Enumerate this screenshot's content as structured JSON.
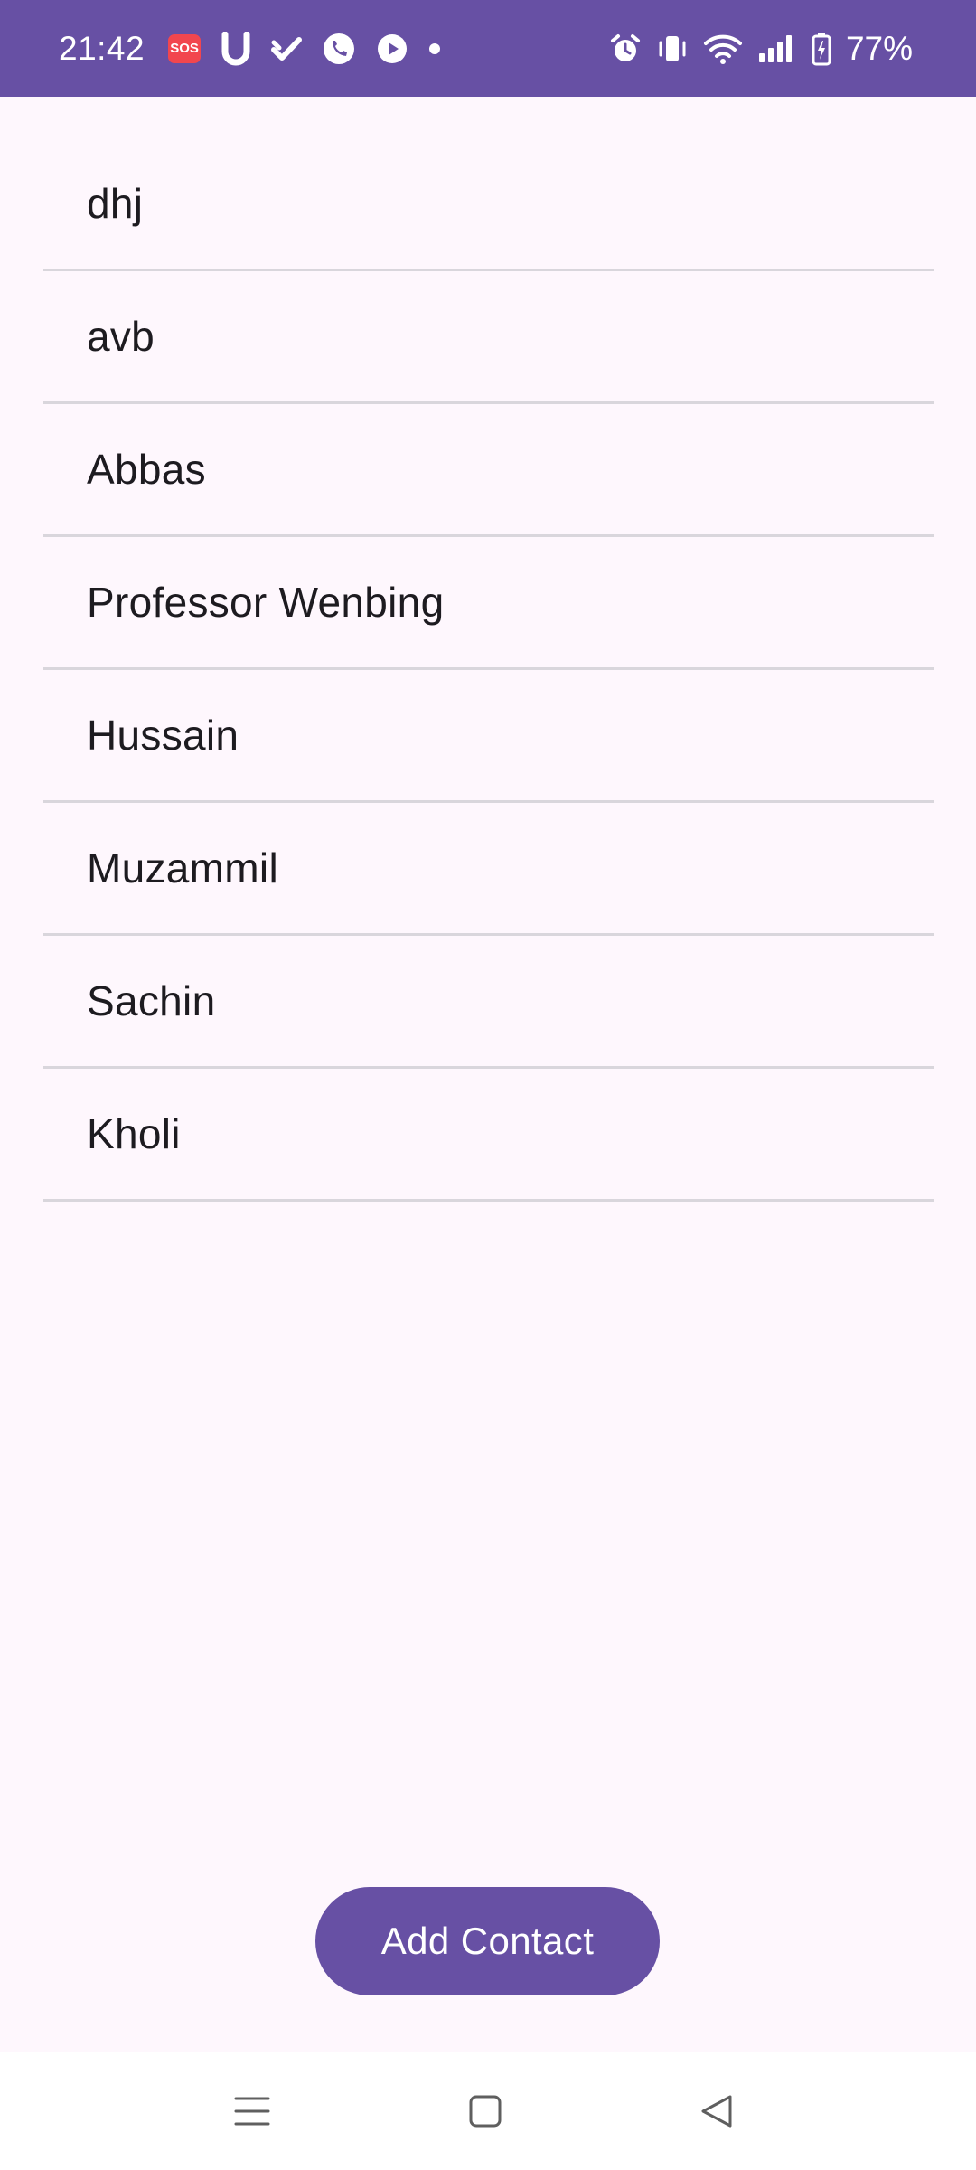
{
  "status_bar": {
    "time": "21:42",
    "sos_label": "SOS",
    "battery_percent": "77%",
    "background_color": "#6750a4",
    "left_icons": [
      "sos-icon",
      "u-app-icon",
      "check-icon",
      "phone-icon",
      "play-app-icon",
      "dot-icon"
    ],
    "right_icons": [
      "alarm-icon",
      "vibrate-icon",
      "wifi-icon",
      "signal-icon",
      "battery-icon"
    ]
  },
  "contacts": {
    "items": [
      {
        "name": "dhj"
      },
      {
        "name": "avb"
      },
      {
        "name": "Abbas"
      },
      {
        "name": "Professor Wenbing"
      },
      {
        "name": "Hussain"
      },
      {
        "name": "Muzammil"
      },
      {
        "name": "Sachin"
      },
      {
        "name": "Kholi"
      }
    ]
  },
  "actions": {
    "add_contact_label": "Add Contact",
    "button_color": "#6750a4"
  },
  "nav_bar": {
    "icons": [
      "menu-icon",
      "home-icon",
      "back-icon"
    ]
  }
}
